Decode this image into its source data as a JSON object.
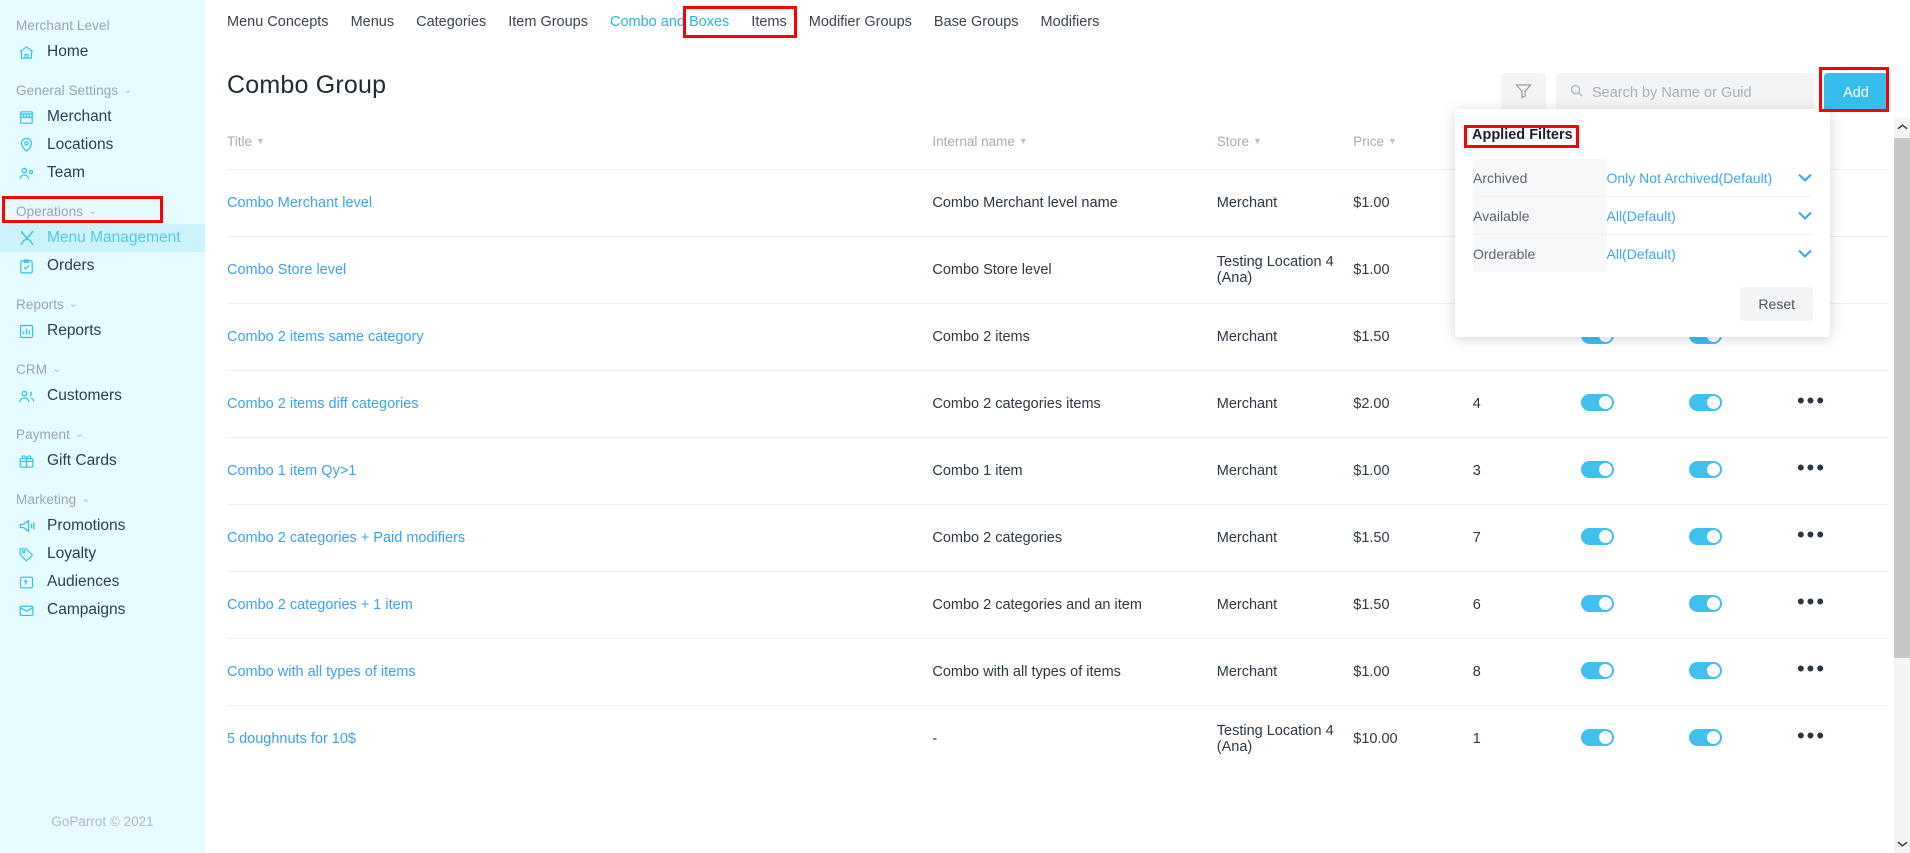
{
  "sidebar": {
    "groups": [
      {
        "label": "Merchant Level",
        "collapsible": false,
        "items": [
          {
            "label": "Home",
            "icon": "home-icon",
            "active": false
          }
        ]
      },
      {
        "label": "General Settings",
        "collapsible": true,
        "items": [
          {
            "label": "Merchant",
            "icon": "store-icon",
            "active": false
          },
          {
            "label": "Locations",
            "icon": "map-pin-icon",
            "active": false
          },
          {
            "label": "Team",
            "icon": "team-icon",
            "active": false
          }
        ]
      },
      {
        "label": "Operations",
        "collapsible": true,
        "items": [
          {
            "label": "Menu Management",
            "icon": "cutlery-icon",
            "active": true
          },
          {
            "label": "Orders",
            "icon": "clipboard-check-icon",
            "active": false
          }
        ]
      },
      {
        "label": "Reports",
        "collapsible": true,
        "items": [
          {
            "label": "Reports",
            "icon": "bar-chart-icon",
            "active": false
          }
        ]
      },
      {
        "label": "CRM",
        "collapsible": true,
        "items": [
          {
            "label": "Customers",
            "icon": "users-icon",
            "active": false
          }
        ]
      },
      {
        "label": "Payment",
        "collapsible": true,
        "items": [
          {
            "label": "Gift Cards",
            "icon": "gift-icon",
            "active": false
          }
        ]
      },
      {
        "label": "Marketing",
        "collapsible": true,
        "items": [
          {
            "label": "Promotions",
            "icon": "megaphone-icon",
            "active": false
          },
          {
            "label": "Loyalty",
            "icon": "tag-icon",
            "active": false
          },
          {
            "label": "Audiences",
            "icon": "audience-icon",
            "active": false
          },
          {
            "label": "Campaigns",
            "icon": "campaign-icon",
            "active": false
          }
        ]
      }
    ],
    "footer": "GoParrot © 2021"
  },
  "tabs": [
    {
      "label": "Menu Concepts",
      "active": false
    },
    {
      "label": "Menus",
      "active": false
    },
    {
      "label": "Categories",
      "active": false
    },
    {
      "label": "Item Groups",
      "active": false
    },
    {
      "label": "Combo and Boxes",
      "active": true
    },
    {
      "label": "Items",
      "active": false
    },
    {
      "label": "Modifier Groups",
      "active": false
    },
    {
      "label": "Base Groups",
      "active": false
    },
    {
      "label": "Modifiers",
      "active": false
    }
  ],
  "page": {
    "title": "Combo Group"
  },
  "toolbar": {
    "filter_icon": "funnel-icon",
    "search_icon": "search-icon",
    "search_placeholder": "Search by Name or Guid",
    "search_value": "",
    "add_label": "Add"
  },
  "filter_popup": {
    "title": "Applied Filters",
    "rows": [
      {
        "label": "Archived",
        "value": "Only Not Archived(Default)"
      },
      {
        "label": "Available",
        "value": "All(Default)"
      },
      {
        "label": "Orderable",
        "value": "All(Default)"
      }
    ],
    "reset_label": "Reset"
  },
  "table": {
    "columns": [
      {
        "key": "title",
        "label": "Title",
        "sortable": true
      },
      {
        "key": "internal",
        "label": "Internal name",
        "sortable": true
      },
      {
        "key": "store",
        "label": "Store",
        "sortable": true
      },
      {
        "key": "price",
        "label": "Price",
        "sortable": true
      },
      {
        "key": "count",
        "label": "",
        "sortable": false
      },
      {
        "key": "toggle1",
        "label": "",
        "sortable": false
      },
      {
        "key": "toggle2",
        "label": "",
        "sortable": false
      },
      {
        "key": "more",
        "label": "",
        "sortable": false
      }
    ],
    "rows": [
      {
        "title": "Combo Merchant level",
        "internal": "Combo Merchant level name",
        "store": "Merchant",
        "price": "$1.00",
        "count": "",
        "toggle1": true,
        "toggle2": true
      },
      {
        "title": "Combo Store level",
        "internal": "Combo Store level",
        "store": "Testing Location 4 (Ana)",
        "price": "$1.00",
        "count": "",
        "toggle1": true,
        "toggle2": true
      },
      {
        "title": "Combo 2 items same category",
        "internal": "Combo 2 items",
        "store": "Merchant",
        "price": "$1.50",
        "count": "",
        "toggle1": true,
        "toggle2": true
      },
      {
        "title": "Combo 2 items diff categories",
        "internal": "Combo 2 categories items",
        "store": "Merchant",
        "price": "$2.00",
        "count": "4",
        "toggle1": true,
        "toggle2": true
      },
      {
        "title": "Combo 1 item Qy>1",
        "internal": "Combo 1 item",
        "store": "Merchant",
        "price": "$1.00",
        "count": "3",
        "toggle1": true,
        "toggle2": true
      },
      {
        "title": "Combo 2 categories + Paid modifiers",
        "internal": "Combo 2 categories",
        "store": "Merchant",
        "price": "$1.50",
        "count": "7",
        "toggle1": true,
        "toggle2": true
      },
      {
        "title": "Combo 2 categories + 1 item",
        "internal": "Combo 2 categories and an item",
        "store": "Merchant",
        "price": "$1.50",
        "count": "6",
        "toggle1": true,
        "toggle2": true
      },
      {
        "title": "Combo with all types of items",
        "internal": "Combo with all types of items",
        "store": "Merchant",
        "price": "$1.00",
        "count": "8",
        "toggle1": true,
        "toggle2": true
      },
      {
        "title": "5 doughnuts for 10$",
        "internal": "-",
        "store": "Testing Location 4 (Ana)",
        "price": "$10.00",
        "count": "1",
        "toggle1": true,
        "toggle2": true
      }
    ],
    "row_menu_icon": "kebab-menu-icon"
  },
  "annotations": {
    "highlight_color": "#ff0000",
    "boxes": [
      "menu-management-sidebar-item",
      "combo-and-boxes-tab",
      "add-button",
      "applied-filters-title"
    ]
  },
  "colors": {
    "accent": "#36bdec",
    "sidebar_bg": "#e6fbff",
    "link": "#3aa3f0",
    "toggle_on": "#3fc0ef"
  }
}
